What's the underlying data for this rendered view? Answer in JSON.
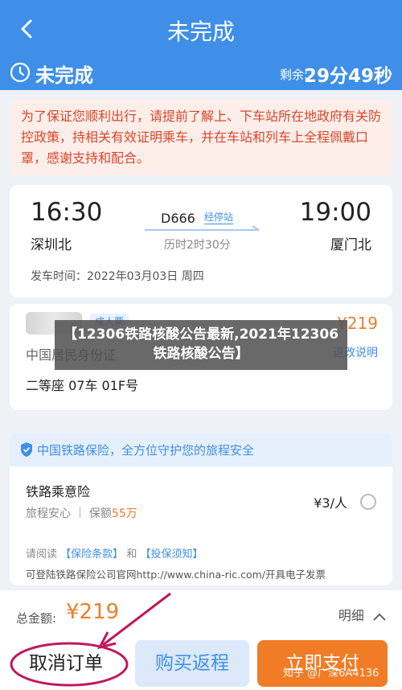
{
  "header": {
    "title": "未完成"
  },
  "status": {
    "label": "未完成",
    "remain_label": "剩余:",
    "remain_time": "29分49秒"
  },
  "notice": {
    "text": "为了保证您顺利出行，请提前了解上、下车站所在地政府有关防控政策，持相关有效证明乘车，并在车站和列车上全程佩戴口罩，感谢支持和配合。"
  },
  "trip": {
    "departure_time": "16:30",
    "departure_station": "深圳北",
    "arrival_time": "19:00",
    "arrival_station": "厦门北",
    "train_number": "D666",
    "stop_tag": "经停站",
    "duration": "历时2时30分",
    "depart_label": "发车时间：",
    "depart_date": "2022年03月03日 周四"
  },
  "passenger": {
    "ticket_type": "成人票",
    "price": "¥219",
    "id_type": "中国居民身份证",
    "refund_link": "退改说明",
    "seat": "二等座 07车 01F号"
  },
  "overlay": {
    "text": "【12306铁路核酸公告最新,2021年12306铁路核酸公告】"
  },
  "insurance": {
    "header": "中国铁路保险，全方位守护您的旅程安全",
    "name": "铁路乘意险",
    "price": "¥3/人",
    "sub_label": "旅程安心 ｜ 保额",
    "amount": "55万",
    "read_label": "请阅读",
    "terms_link": "【保险条款】",
    "and": "和",
    "notice_link": "【投保须知】",
    "company_text": "可登陆铁路保险公司官网http://www.china-ric.com/开具电子发票"
  },
  "bottom": {
    "total_label": "总金额:",
    "total_value": "¥219",
    "detail_label": "明细",
    "cancel_label": "取消订单",
    "return_label": "购买返程",
    "pay_label": "立即支付"
  },
  "watermark": "知乎 @广深6A4136",
  "colors": {
    "primary": "#3f8fe8",
    "accent": "#f07c26",
    "notice_text": "#d9472b",
    "annotation": "#c0185c"
  }
}
